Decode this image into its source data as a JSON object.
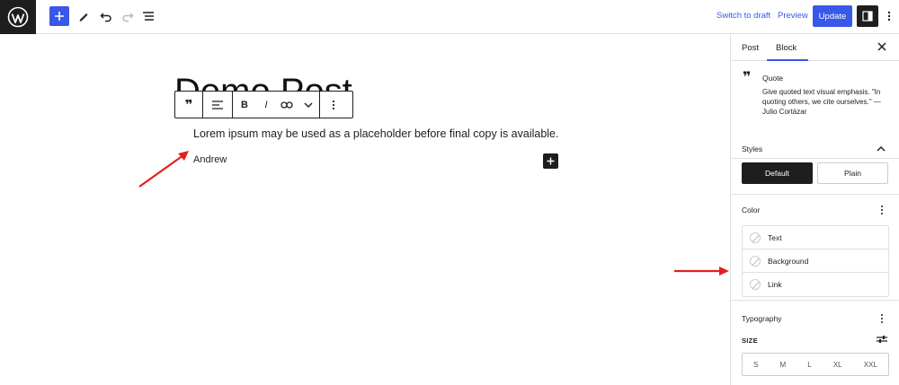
{
  "topbar": {
    "switch_to_draft": "Switch to draft",
    "preview": "Preview",
    "update": "Update",
    "icons": [
      "wordpress-logo-icon",
      "plus-icon",
      "pencil-icon",
      "undo-icon",
      "redo-icon",
      "list-view-icon",
      "settings-sidebar-icon",
      "more-vertical-icon"
    ],
    "accent_color": "#3858e9"
  },
  "editor": {
    "post_title": "Demo Post",
    "quote_text": "Lorem ipsum may be used as a placeholder before final copy is available.",
    "quote_citation": "Andrew",
    "toolbar": {
      "bold": "B",
      "italic": "I"
    },
    "annotation_color": "#e02020"
  },
  "sidebar": {
    "tabs": [
      {
        "label": "Post"
      },
      {
        "label": "Block"
      }
    ],
    "block_card": {
      "title": "Quote",
      "description": "Give quoted text visual emphasis. \"In quoting others, we cite ourselves.\" — Julio Cortázar"
    },
    "styles": {
      "title": "Styles",
      "options": [
        "Default",
        "Plain"
      ],
      "selected": "Default"
    },
    "color": {
      "title": "Color",
      "items": [
        {
          "label": "Text"
        },
        {
          "label": "Background"
        },
        {
          "label": "Link"
        }
      ]
    },
    "typography": {
      "title": "Typography",
      "size_label": "SIZE",
      "sizes": [
        "S",
        "M",
        "L",
        "XL",
        "XXL"
      ]
    }
  }
}
